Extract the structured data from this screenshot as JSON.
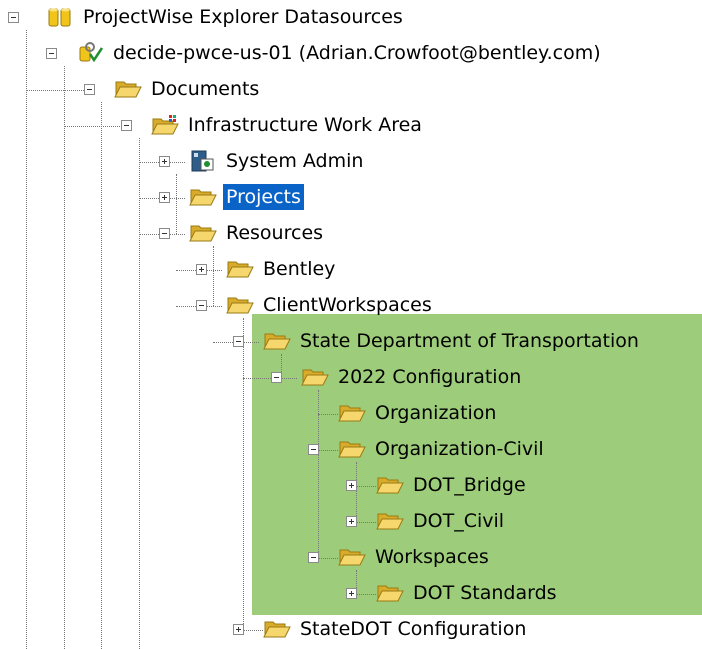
{
  "tree": {
    "root": "ProjectWise Explorer Datasources",
    "datasource": "decide-pwce-us-01 (Adrian.Crowfoot@bentley.com)",
    "documents": "Documents",
    "work_area": "Infrastructure Work Area",
    "system_admin": "System Admin",
    "projects": "Projects",
    "resources": "Resources",
    "bentley": "Bentley",
    "client_workspaces": "ClientWorkspaces",
    "state_dot": "State Department of Transportation",
    "config_2022": "2022 Configuration",
    "organization": "Organization",
    "organization_civil": "Organization-Civil",
    "dot_bridge": "DOT_Bridge",
    "dot_civil": "DOT_Civil",
    "workspaces": "Workspaces",
    "dot_standards": "DOT Standards",
    "statedot_config": "StateDOT Configuration"
  },
  "colors": {
    "highlight": "#9dcd7a",
    "selection": "#0a64c8",
    "folder": "#e8c23a"
  }
}
